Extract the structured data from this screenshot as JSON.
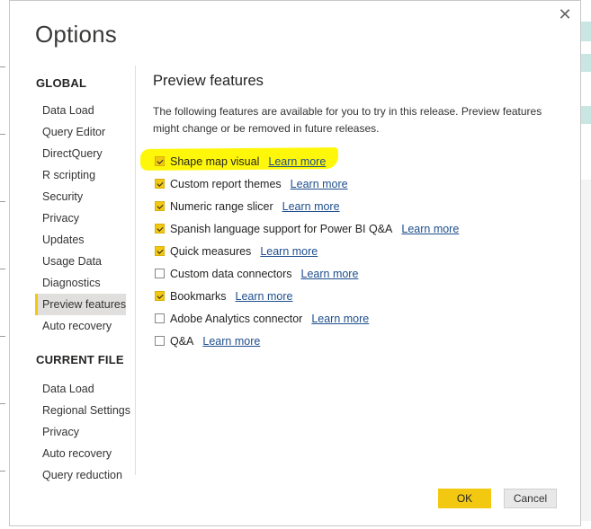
{
  "dialog": {
    "title": "Options",
    "close_glyph": "✕"
  },
  "sidebar": {
    "global_header": "GLOBAL",
    "global_items": [
      {
        "label": "Data Load"
      },
      {
        "label": "Query Editor"
      },
      {
        "label": "DirectQuery"
      },
      {
        "label": "R scripting"
      },
      {
        "label": "Security"
      },
      {
        "label": "Privacy"
      },
      {
        "label": "Updates"
      },
      {
        "label": "Usage Data"
      },
      {
        "label": "Diagnostics"
      },
      {
        "label": "Preview features",
        "active": true
      },
      {
        "label": "Auto recovery"
      }
    ],
    "current_file_header": "CURRENT FILE",
    "current_file_items": [
      {
        "label": "Data Load"
      },
      {
        "label": "Regional Settings"
      },
      {
        "label": "Privacy"
      },
      {
        "label": "Auto recovery"
      },
      {
        "label": "Query reduction"
      }
    ]
  },
  "content": {
    "title": "Preview features",
    "description": "The following features are available for you to try in this release. Preview features might change or be removed in future releases.",
    "features": [
      {
        "label": "Shape map visual",
        "checked": true,
        "link": "Learn more",
        "highlighted": true
      },
      {
        "label": "Custom report themes",
        "checked": true,
        "link": "Learn more"
      },
      {
        "label": "Numeric range slicer",
        "checked": true,
        "link": "Learn more"
      },
      {
        "label": "Spanish language support for Power BI Q&A",
        "checked": true,
        "link": "Learn more"
      },
      {
        "label": "Quick measures",
        "checked": true,
        "link": "Learn more"
      },
      {
        "label": "Custom data connectors",
        "checked": false,
        "link": "Learn more"
      },
      {
        "label": "Bookmarks",
        "checked": true,
        "link": "Learn more"
      },
      {
        "label": "Adobe Analytics connector",
        "checked": false,
        "link": "Learn more"
      },
      {
        "label": "Q&A",
        "checked": false,
        "link": "Learn more"
      }
    ]
  },
  "buttons": {
    "ok_label": "OK",
    "cancel_label": "Cancel"
  },
  "colors": {
    "accent": "#f2c811",
    "highlight": "#fff70a",
    "link": "#1e4e8c"
  }
}
